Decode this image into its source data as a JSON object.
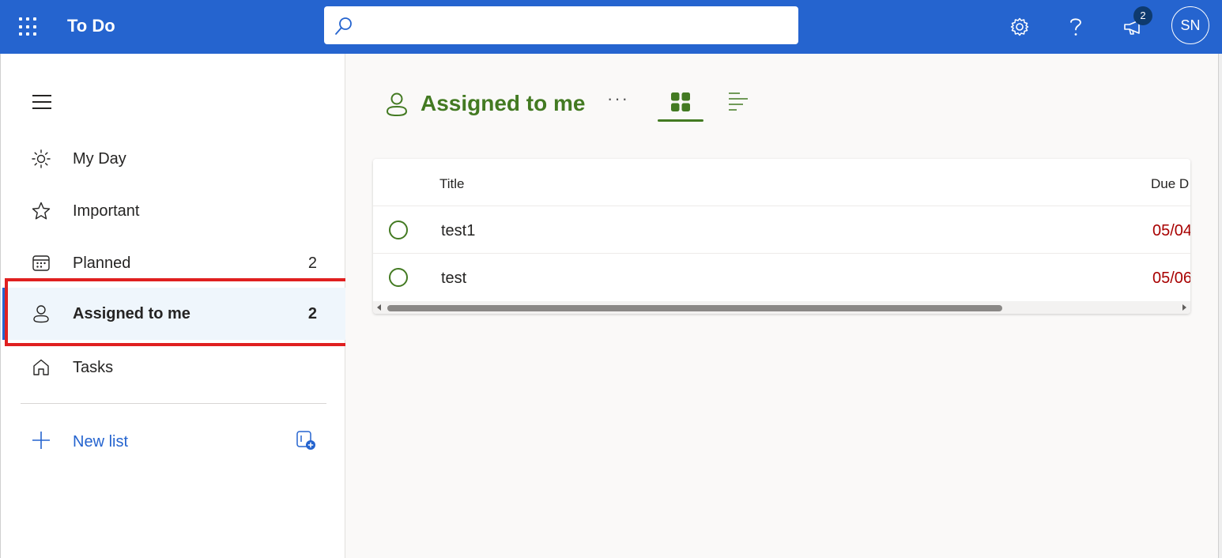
{
  "app": {
    "title": "To Do",
    "brand_color": "#2564cf",
    "list_color": "#437a22"
  },
  "search": {
    "placeholder": "",
    "value": ""
  },
  "header": {
    "icons": [
      "app-launcher-icon",
      "search-icon",
      "gear-icon",
      "help-icon",
      "megaphone-icon"
    ],
    "notification_count": "2",
    "avatar_initials": "SN"
  },
  "sidebar": {
    "items": [
      {
        "label": "My Day",
        "count": "",
        "icon": "sun-icon"
      },
      {
        "label": "Important",
        "count": "",
        "icon": "star-icon"
      },
      {
        "label": "Planned",
        "count": "2",
        "icon": "calendar-icon"
      },
      {
        "label": "Assigned to me",
        "count": "2",
        "icon": "person-icon",
        "active": true
      },
      {
        "label": "Tasks",
        "count": "",
        "icon": "home-icon"
      }
    ],
    "new_list": {
      "label": "New list"
    }
  },
  "main": {
    "list_title": "Assigned to me",
    "more": "···",
    "table": {
      "columns": [
        "Title",
        "Due D"
      ],
      "rows": [
        {
          "title": "test1",
          "due": "05/04"
        },
        {
          "title": "test",
          "due": "05/06"
        }
      ]
    }
  }
}
